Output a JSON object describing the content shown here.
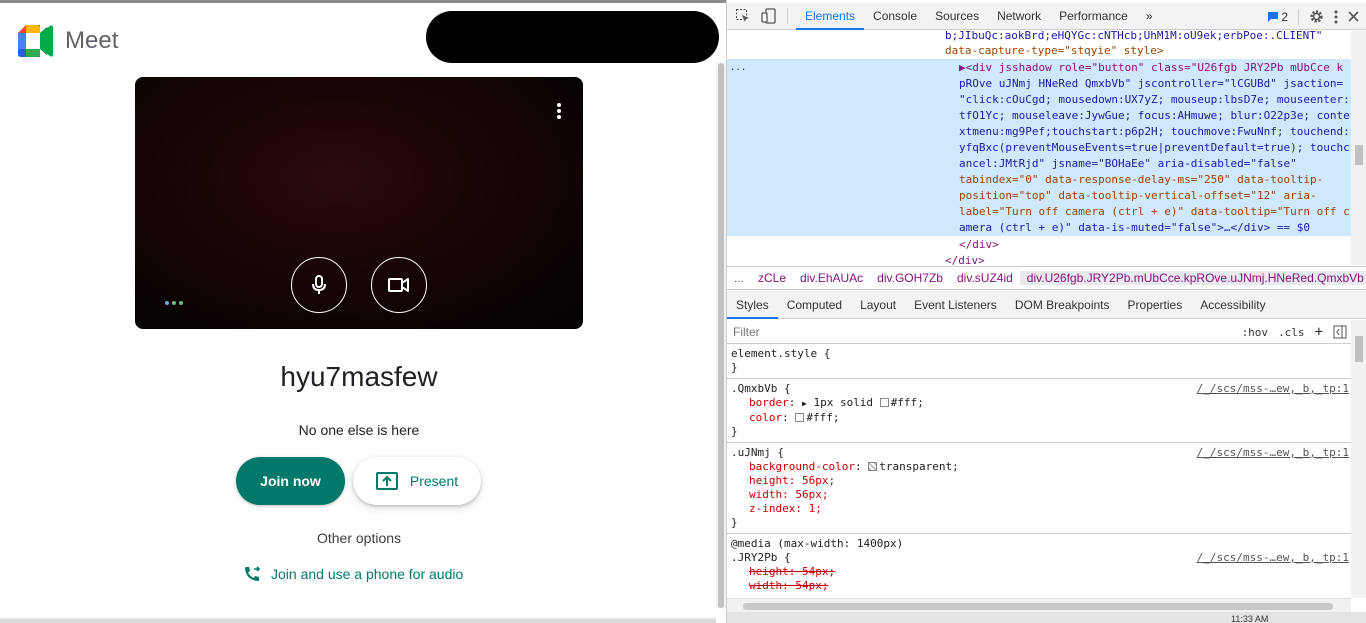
{
  "meet": {
    "logo_text": "Meet",
    "meeting_name": "hyu7masfew",
    "status": "No one else is here",
    "join_label": "Join now",
    "present_label": "Present",
    "other_options": "Other options",
    "phone_label": "Join and use a phone for audio"
  },
  "devtools": {
    "tabs": [
      "Elements",
      "Console",
      "Sources",
      "Network",
      "Performance"
    ],
    "more_tabs": "»",
    "issues_count": "2",
    "dom_lines": [
      "b;JIbuQc:aokBrd;eHQYGc:cNTHcb;UhM1M:oU9ek;erbPoe:.CLIENT\"",
      "data-capture-type=\"stqyie\" style>",
      "▶<div jsshadow role=\"button\" class=\"U26fgb JRY2Pb mUbCce k",
      "pROve uJNmj HNeRed QmxbVb\" jscontroller=\"lCGUBd\" jsaction=",
      "\"click:cOuCgd; mousedown:UX7yZ; mouseup:lbsD7e; mouseenter:",
      "tfO1Yc; mouseleave:JywGue; focus:AHmuwe; blur:O22p3e; conte",
      "xtmenu:mg9Pef;touchstart:p6p2H; touchmove:FwuNnf; touchend:",
      "yfqBxc(preventMouseEvents=true|preventDefault=true); touchc",
      "ancel:JMtRjd\" jsname=\"BOHaEe\" aria-disabled=\"false\"",
      "tabindex=\"0\" data-response-delay-ms=\"250\" data-tooltip-",
      "position=\"top\" data-tooltip-vertical-offset=\"12\" aria-",
      "label=\"Turn off camera (ctrl + e)\" data-tooltip=\"Turn off c",
      "amera (ctrl + e)\" data-is-muted=\"false\">…</div> == $0",
      "</div>",
      "</div>"
    ],
    "ellipsis": "...",
    "breadcrumbs": [
      {
        "tag": "",
        "cls": "zCLe"
      },
      {
        "tag": "div",
        "cls": ".EhAUAc"
      },
      {
        "tag": "div",
        "cls": ".GOH7Zb"
      },
      {
        "tag": "div",
        "cls": ".sUZ4id"
      },
      {
        "tag": "div",
        "cls": ".U26fgb.JRY2Pb.mUbCce.kpROve.uJNmj.HNeRed.QmxbVb"
      }
    ],
    "crumb_ellipsis": "...",
    "subtabs": [
      "Styles",
      "Computed",
      "Layout",
      "Event Listeners",
      "DOM Breakpoints",
      "Properties",
      "Accessibility"
    ],
    "filter_placeholder": "Filter",
    "hov": ":hov",
    "cls": ".cls",
    "plus": "+",
    "styles": {
      "element_style": "element.style {",
      "close": "}",
      "rule1": {
        "selector": ".QmxbVb {",
        "source": "/_/scs/mss-…ew,_b,_tp:1",
        "props": [
          {
            "name": "border",
            "value": "1px solid",
            "color": "#fff"
          },
          {
            "name": "color",
            "value": "",
            "color": "#fff"
          }
        ]
      },
      "rule2": {
        "selector": ".uJNmj {",
        "source": "/_/scs/mss-…ew,_b,_tp:1",
        "bg_name": "background-color",
        "bg_value": "transparent;",
        "props": [
          "height: 56px;",
          "width: 56px;",
          "z-index: 1;"
        ]
      },
      "media": "@media (max-width: 1400px)",
      "rule3": {
        "selector": ".JRY2Pb {",
        "source": "/_/scs/mss-…ew,_b,_tp:1",
        "props": [
          "height: 54px;",
          "width: 54px;"
        ]
      }
    },
    "time": "11:33 AM"
  }
}
